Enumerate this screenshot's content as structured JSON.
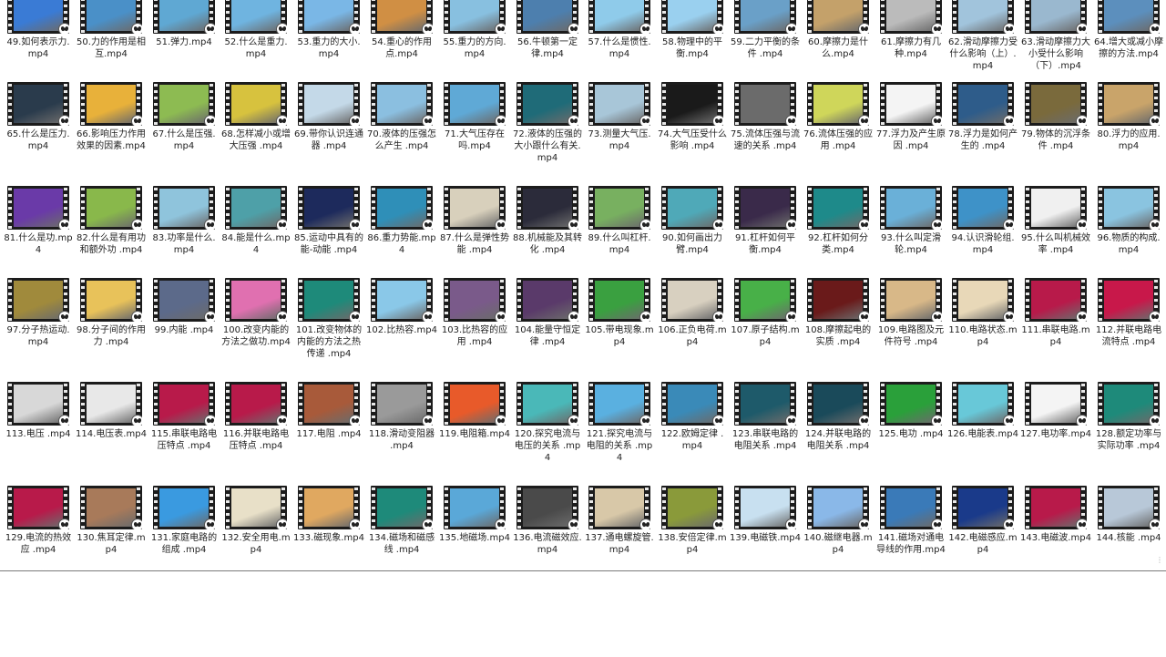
{
  "grid": {
    "rows": [
      {
        "items": [
          {
            "label": "49.如何表示力.mp4",
            "thumb": "#3a7bd5"
          },
          {
            "label": "50.力的作用是相互.mp4",
            "thumb": "#4a90c8"
          },
          {
            "label": "51.弹力.mp4",
            "thumb": "#5fa8d3"
          },
          {
            "label": "52.什么是重力.mp4",
            "thumb": "#6fb4e0"
          },
          {
            "label": "53.重力的大小.mp4",
            "thumb": "#7ab7e6"
          },
          {
            "label": "54.重心的作用点.mp4",
            "thumb": "#d08f44"
          },
          {
            "label": "55.重力的方向.mp4",
            "thumb": "#88c0e0"
          },
          {
            "label": "56.牛顿第一定律.mp4",
            "thumb": "#4d7fae"
          },
          {
            "label": "57.什么是惯性.mp4",
            "thumb": "#8fcbea"
          },
          {
            "label": "58.物理中的平衡.mp4",
            "thumb": "#9ad0ef"
          },
          {
            "label": "59.二力平衡的条件 .mp4",
            "thumb": "#6aa0c8"
          },
          {
            "label": "60.摩擦力是什么.mp4",
            "thumb": "#c4a16a"
          },
          {
            "label": "61.摩擦力有几种.mp4",
            "thumb": "#bbbbbb"
          },
          {
            "label": "62.滑动摩擦力受什么影响（上）.mp4",
            "thumb": "#a1c4dc"
          },
          {
            "label": "63.滑动摩擦力大小受什么影响（下）.mp4",
            "thumb": "#9ab8cf"
          },
          {
            "label": "64.增大或减小摩擦的方法.mp4",
            "thumb": "#5c8fbd"
          }
        ]
      },
      {
        "items": [
          {
            "label": "65.什么是压力.mp4",
            "thumb": "#2a3b4c"
          },
          {
            "label": "66.影响压力作用效果的因素.mp4",
            "thumb": "#e8b13a"
          },
          {
            "label": "67.什么是压强.mp4",
            "thumb": "#8dbb52"
          },
          {
            "label": "68.怎样减小或增大压强 .mp4",
            "thumb": "#d7c23e"
          },
          {
            "label": "69.带你认识连通器 .mp4",
            "thumb": "#c4d9e8"
          },
          {
            "label": "70.液体的压强怎么产生 .mp4",
            "thumb": "#8bbfe0"
          },
          {
            "label": "71.大气压存在吗.mp4",
            "thumb": "#5fa9d6"
          },
          {
            "label": "72.液体的压强的大小跟什么有关.mp4",
            "thumb": "#1f6b78"
          },
          {
            "label": "73.测量大气压.mp4",
            "thumb": "#a8c6d8"
          },
          {
            "label": "74.大气压受什么影响 .mp4",
            "thumb": "#1a1a1a"
          },
          {
            "label": "75.流体压强与流速的关系 .mp4",
            "thumb": "#6b6b6b"
          },
          {
            "label": "76.流体压强的应用 .mp4",
            "thumb": "#cfd65a"
          },
          {
            "label": "77.浮力及产生原因 .mp4",
            "thumb": "#f4f4f4"
          },
          {
            "label": "78.浮力是如何产生的 .mp4",
            "thumb": "#2e5c8a"
          },
          {
            "label": "79.物体的沉浮条件 .mp4",
            "thumb": "#7a6a3c"
          },
          {
            "label": "80.浮力的应用.mp4",
            "thumb": "#c9a46a"
          }
        ]
      },
      {
        "items": [
          {
            "label": "81.什么是功.mp4",
            "thumb": "#6a3aa8"
          },
          {
            "label": "82.什么是有用功和额外功 .mp4",
            "thumb": "#89b84b"
          },
          {
            "label": "83.功率是什么.mp4",
            "thumb": "#8fc4dc"
          },
          {
            "label": "84.能是什么.mp4",
            "thumb": "#4ea0a8"
          },
          {
            "label": "85.运动中具有的能-动能 .mp4",
            "thumb": "#1d2a5c"
          },
          {
            "label": "86.重力势能.mp4",
            "thumb": "#2f8fb8"
          },
          {
            "label": "87.什么是弹性势能 .mp4",
            "thumb": "#d8d0bc"
          },
          {
            "label": "88.机械能及其转化 .mp4",
            "thumb": "#2b2b3a"
          },
          {
            "label": "89.什么叫杠杆.mp4",
            "thumb": "#78b060"
          },
          {
            "label": "90.如何画出力臂.mp4",
            "thumb": "#4fa9b8"
          },
          {
            "label": "91.杠杆如何平衡.mp4",
            "thumb": "#3a2a4a"
          },
          {
            "label": "92.杠杆如何分类.mp4",
            "thumb": "#1e8a8a"
          },
          {
            "label": "93.什么叫定滑轮.mp4",
            "thumb": "#6ab0d8"
          },
          {
            "label": "94.认识滑轮组.mp4",
            "thumb": "#3e92c8"
          },
          {
            "label": "95.什么叫机械效率 .mp4",
            "thumb": "#f0f0f0"
          },
          {
            "label": "96.物质的构成.mp4",
            "thumb": "#8ac4e0"
          }
        ]
      },
      {
        "items": [
          {
            "label": "97.分子热运动.mp4",
            "thumb": "#a08a3c"
          },
          {
            "label": "98.分子间的作用力 .mp4",
            "thumb": "#e8c25a"
          },
          {
            "label": "99.内能 .mp4",
            "thumb": "#5c6a8a"
          },
          {
            "label": "100.改变内能的方法之做功.mp4",
            "thumb": "#e070b0"
          },
          {
            "label": "101.改变物体的内能的方法之热传递 .mp4",
            "thumb": "#1e8a7a"
          },
          {
            "label": "102.比热容.mp4",
            "thumb": "#8ac8e8"
          },
          {
            "label": "103.比热容的应用 .mp4",
            "thumb": "#7a5a8a"
          },
          {
            "label": "104.能量守恒定律 .mp4",
            "thumb": "#5a3a6a"
          },
          {
            "label": "105.带电现象.mp4",
            "thumb": "#3aa040"
          },
          {
            "label": "106.正负电荷.mp4",
            "thumb": "#d8d0c0"
          },
          {
            "label": "107.原子结构.mp4",
            "thumb": "#48b048"
          },
          {
            "label": "108.摩擦起电的实质 .mp4",
            "thumb": "#6a1a1a"
          },
          {
            "label": "109.电路图及元件符号 .mp4",
            "thumb": "#d8b888"
          },
          {
            "label": "110.电路状态.mp4",
            "thumb": "#e8d8b8"
          },
          {
            "label": "111.串联电路.mp4",
            "thumb": "#b81a4a"
          },
          {
            "label": "112.并联电路电流特点 .mp4",
            "thumb": "#c8184a"
          }
        ]
      },
      {
        "items": [
          {
            "label": "113.电压 .mp4",
            "thumb": "#d8d8d8"
          },
          {
            "label": "114.电压表.mp4",
            "thumb": "#e8e8e8"
          },
          {
            "label": "115.串联电路电压特点 .mp4",
            "thumb": "#b81a4a"
          },
          {
            "label": "116.并联电路电压特点 .mp4",
            "thumb": "#b81a4a"
          },
          {
            "label": "117.电阻 .mp4",
            "thumb": "#a85a3a"
          },
          {
            "label": "118.滑动变阻器 .mp4",
            "thumb": "#9a9a9a"
          },
          {
            "label": "119.电阻箱.mp4",
            "thumb": "#e85a2a"
          },
          {
            "label": "120.探究电流与电压的关系 .mp4",
            "thumb": "#4ab8b8"
          },
          {
            "label": "121.探究电流与电阻的关系 .mp4",
            "thumb": "#5ab0e0"
          },
          {
            "label": "122.欧姆定律 .mp4",
            "thumb": "#3a8ab8"
          },
          {
            "label": "123.串联电路的电阻关系 .mp4",
            "thumb": "#1e5a6a"
          },
          {
            "label": "124.并联电路的电阻关系 .mp4",
            "thumb": "#1a4a5a"
          },
          {
            "label": "125.电功 .mp4",
            "thumb": "#2aa03a"
          },
          {
            "label": "126.电能表.mp4",
            "thumb": "#68c8d8"
          },
          {
            "label": "127.电功率.mp4",
            "thumb": "#f4f4f4"
          },
          {
            "label": "128.额定功率与实际功率 .mp4",
            "thumb": "#1e8a7a"
          }
        ]
      },
      {
        "items": [
          {
            "label": "129.电流的热效应 .mp4",
            "thumb": "#b81a4a"
          },
          {
            "label": "130.焦耳定律.mp4",
            "thumb": "#a87a5a"
          },
          {
            "label": "131.家庭电路的组成 .mp4",
            "thumb": "#3a9ae0"
          },
          {
            "label": "132.安全用电.mp4",
            "thumb": "#e8e0c8"
          },
          {
            "label": "133.磁现象.mp4",
            "thumb": "#e0a860"
          },
          {
            "label": "134.磁场和磁感线 .mp4",
            "thumb": "#1e8a7a"
          },
          {
            "label": "135.地磁场.mp4",
            "thumb": "#5aa8d8"
          },
          {
            "label": "136.电流磁效应.mp4",
            "thumb": "#4a4a4a"
          },
          {
            "label": "137.通电螺旋管.mp4",
            "thumb": "#d8c8a8"
          },
          {
            "label": "138.安倍定律.mp4",
            "thumb": "#8a9a3a"
          },
          {
            "label": "139.电磁铁.mp4",
            "thumb": "#c8e0f0"
          },
          {
            "label": "140.磁继电器.mp4",
            "thumb": "#8ab8e8"
          },
          {
            "label": "141.磁场对通电导线的作用.mp4",
            "thumb": "#3a7ab8"
          },
          {
            "label": "142.电磁感应.mp4",
            "thumb": "#1a3a8a"
          },
          {
            "label": "143.电磁波.mp4",
            "thumb": "#b81a4a"
          },
          {
            "label": "144.核能 .mp4",
            "thumb": "#b8c8d8"
          }
        ]
      }
    ]
  }
}
